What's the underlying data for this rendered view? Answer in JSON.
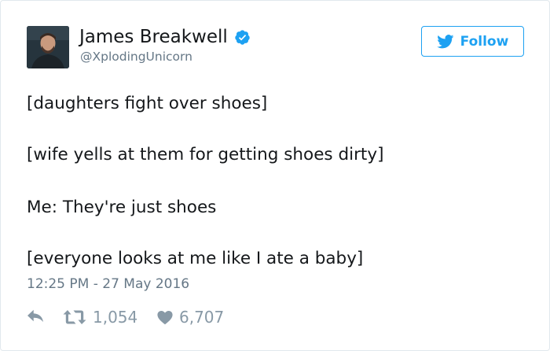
{
  "author": {
    "name": "James Breakwell",
    "handle": "@XplodingUnicorn",
    "verified": true
  },
  "follow_button": {
    "label": "Follow",
    "icon": "twitter-bird-icon"
  },
  "tweet": {
    "lines": [
      "[daughters fight over shoes]",
      "[wife yells at them for getting shoes dirty]",
      "Me: They're just shoes",
      "[everyone looks at me like I ate a baby]"
    ],
    "timestamp": "12:25 PM - 27 May 2016"
  },
  "actions": {
    "reply": {
      "icon": "reply-icon"
    },
    "retweet": {
      "icon": "retweet-icon",
      "count": "1,054"
    },
    "like": {
      "icon": "heart-icon",
      "count": "6,707"
    }
  },
  "colors": {
    "accent": "#1da1f2",
    "text": "#14171a",
    "muted": "#657786",
    "action": "#8899a6",
    "border": "#e1e8ed"
  }
}
